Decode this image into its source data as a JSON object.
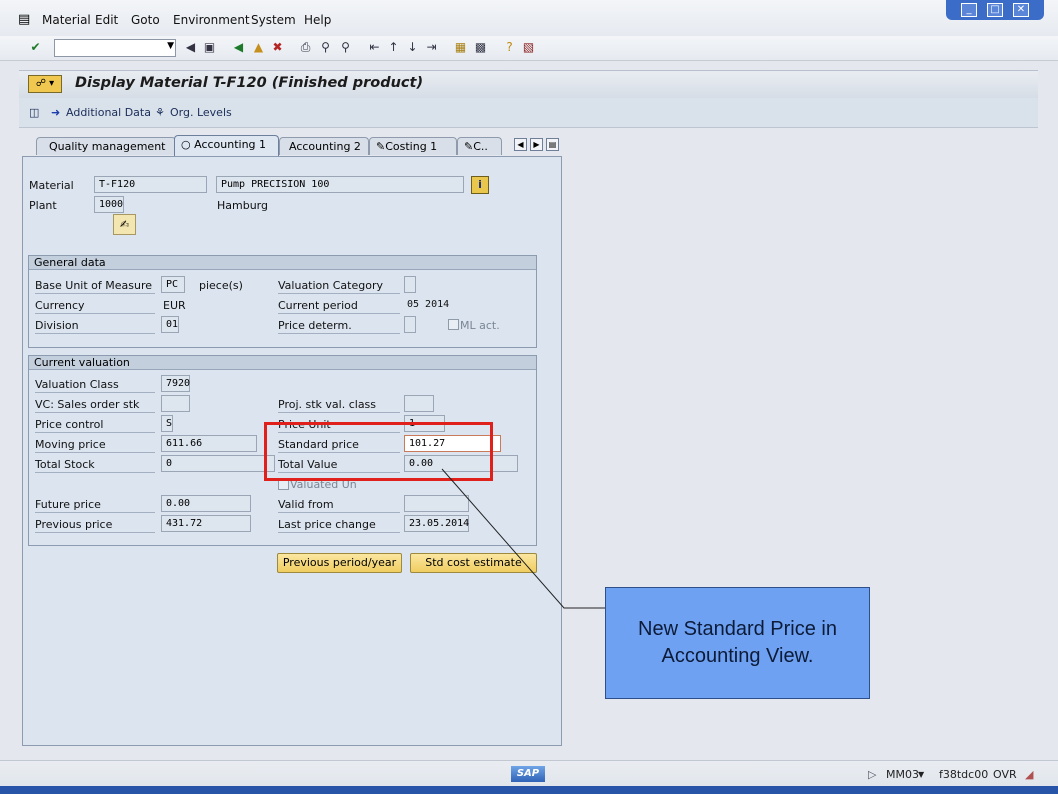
{
  "menu": {
    "items": [
      "Material",
      "Edit",
      "Goto",
      "Environment",
      "System",
      "Help"
    ]
  },
  "window_controls": [
    "minimize",
    "restore",
    "close"
  ],
  "title": "Display Material T-F120 (Finished product)",
  "app_toolbar": {
    "additional_data": "Additional Data",
    "org_levels": "Org. Levels"
  },
  "tabs": [
    {
      "label": "Quality management",
      "active": false
    },
    {
      "label": "Accounting 1",
      "active": true
    },
    {
      "label": "Accounting 2",
      "active": false
    },
    {
      "label": "Costing 1",
      "active": false
    },
    {
      "label": "C..",
      "active": false
    }
  ],
  "header": {
    "material_label": "Material",
    "material_value": "T-F120",
    "material_desc": "Pump PRECISION 100",
    "plant_label": "Plant",
    "plant_value": "1000",
    "plant_desc": "Hamburg"
  },
  "general_data": {
    "title": "General data",
    "buom_label": "Base Unit of Measure",
    "buom_value": "PC",
    "buom_text": "piece(s)",
    "currency_label": "Currency",
    "currency_value": "EUR",
    "division_label": "Division",
    "division_value": "01",
    "valcat_label": "Valuation Category",
    "valcat_value": "",
    "curper_label": "Current period",
    "curper_value": "05 2014",
    "pricedet_label": "Price determ.",
    "pricedet_value": "",
    "mlact_label": "ML act."
  },
  "current_valuation": {
    "title": "Current valuation",
    "valclass_label": "Valuation Class",
    "valclass_value": "7920",
    "vcsales_label": "VC: Sales order stk",
    "vcsales_value": "",
    "projstk_label": "Proj. stk val. class",
    "projstk_value": "",
    "pricectrl_label": "Price control",
    "pricectrl_value": "S",
    "priceunit_label": "Price Unit",
    "priceunit_value": "1",
    "movprice_label": "Moving price",
    "movprice_value": "611.66",
    "stdprice_label": "Standard price",
    "stdprice_value": "101.27",
    "totstock_label": "Total Stock",
    "totstock_value": "0",
    "totvalue_label": "Total Value",
    "totvalue_value": "0.00",
    "valuated_label": "Valuated Un",
    "futprice_label": "Future price",
    "futprice_value": "0.00",
    "validfrom_label": "Valid from",
    "validfrom_value": "",
    "prevprice_label": "Previous price",
    "prevprice_value": "431.72",
    "lastchange_label": "Last price change",
    "lastchange_value": "23.05.2014"
  },
  "buttons": {
    "prev_period": "Previous period/year",
    "std_cost": "Std cost estimate"
  },
  "callout": {
    "line1": "New Standard Price in",
    "line2": "Accounting View."
  },
  "status": {
    "transaction": "MM03",
    "server": "f38tdc00",
    "mode": "OVR",
    "logo": "SAP"
  },
  "colors": {
    "highlight": "#e0201b",
    "callout_bg": "#6fa1f2",
    "sap_button": "#f0cd61"
  }
}
